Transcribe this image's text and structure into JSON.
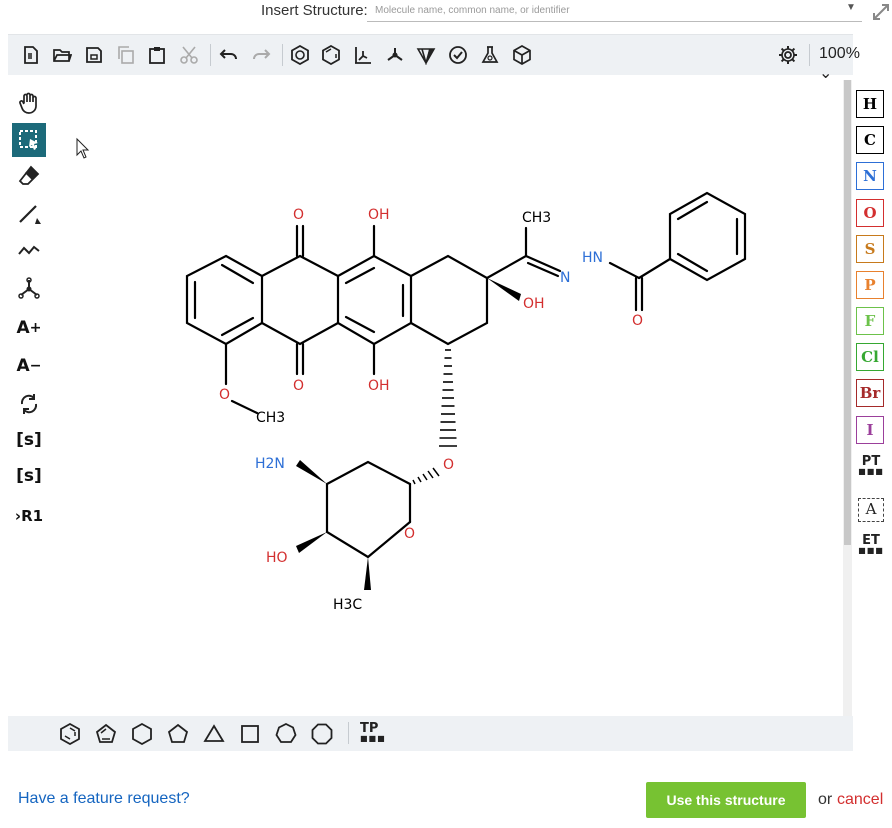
{
  "insert": {
    "label": "Insert Structure:",
    "placeholder": "Molecule name, common name, or identifier",
    "value": ""
  },
  "toolbar": {
    "zoom": "100%",
    "icons": [
      "new-file-icon",
      "open-folder-icon",
      "save-icon",
      "copy-icon",
      "paste-icon",
      "cut-icon",
      "undo-icon",
      "redo-icon",
      "aromatize-icon",
      "dearomatize-icon",
      "layout-icon",
      "clean-icon",
      "stereo-icon",
      "check-icon",
      "calculate-icon",
      "3d-view-icon",
      "settings-icon"
    ]
  },
  "left_tools": {
    "charge_plus": "A",
    "charge_minus": "A",
    "sgroup": "[s]",
    "sgroup_add": "[s]",
    "rgroup": "R1",
    "active_tool": "select-lasso"
  },
  "atoms": [
    {
      "symbol": "H",
      "color": "#000000"
    },
    {
      "symbol": "C",
      "color": "#000000"
    },
    {
      "symbol": "N",
      "color": "#2d6fd6"
    },
    {
      "symbol": "O",
      "color": "#d32f2f"
    },
    {
      "symbol": "S",
      "color": "#c77a1c"
    },
    {
      "symbol": "P",
      "color": "#e8812e"
    },
    {
      "symbol": "F",
      "color": "#6cc24a"
    },
    {
      "symbol": "Cl",
      "color": "#36a832"
    },
    {
      "symbol": "Br",
      "color": "#a52a2a"
    },
    {
      "symbol": "I",
      "color": "#9b3f9b"
    }
  ],
  "right_tools": {
    "periodic_table": "PT",
    "extended_table": "ET",
    "text_tool": "A"
  },
  "bottom": {
    "template_panel": "TP",
    "shapes": [
      "benzene",
      "cyclopentadiene",
      "cyclohexane",
      "cyclopentane",
      "cyclopropane",
      "cyclobutane",
      "cycloheptane",
      "cyclooctane"
    ]
  },
  "molecule": {
    "labels": {
      "o1": "O",
      "oh1": "OH",
      "ch3a": "CH3",
      "hn": "HN",
      "n": "N",
      "oh2": "OH",
      "o2": "O",
      "o3": "O",
      "oh3": "OH",
      "o4": "O",
      "ch3b": "CH3",
      "o5": "O",
      "h2n": "H2N",
      "o6": "O",
      "ho": "HO",
      "h3c": "H3C"
    },
    "colors": {
      "bond": "#000000",
      "oxygen": "#d32f2f",
      "nitrogen": "#2d6fd6"
    }
  },
  "footer": {
    "feature_request": "Have a feature request?",
    "use_button": "Use this structure",
    "or": "or",
    "cancel": "cancel"
  }
}
